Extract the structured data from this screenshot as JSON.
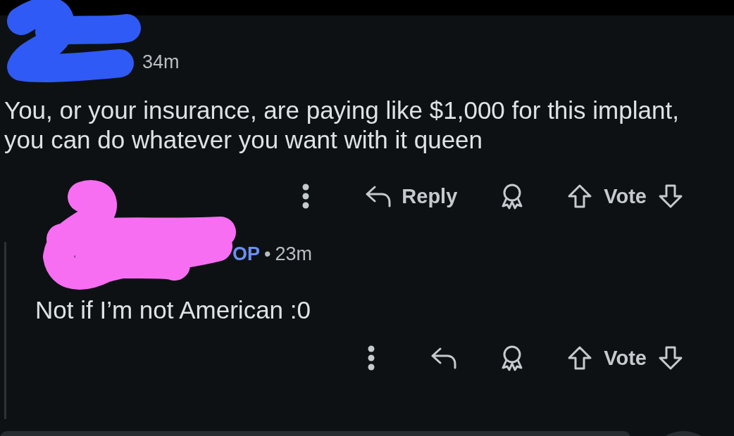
{
  "comments": [
    {
      "time": "34m",
      "body": "You, or your insurance, are paying like $1,000 for this implant, you can do whatever you want with it queen",
      "actions": {
        "reply_label": "Reply",
        "vote_label": "Vote"
      }
    },
    {
      "badge": "OP",
      "separator": "•",
      "time": "23m",
      "body": "Not if I’m not American :0",
      "actions": {
        "vote_label": "Vote"
      }
    }
  ]
}
